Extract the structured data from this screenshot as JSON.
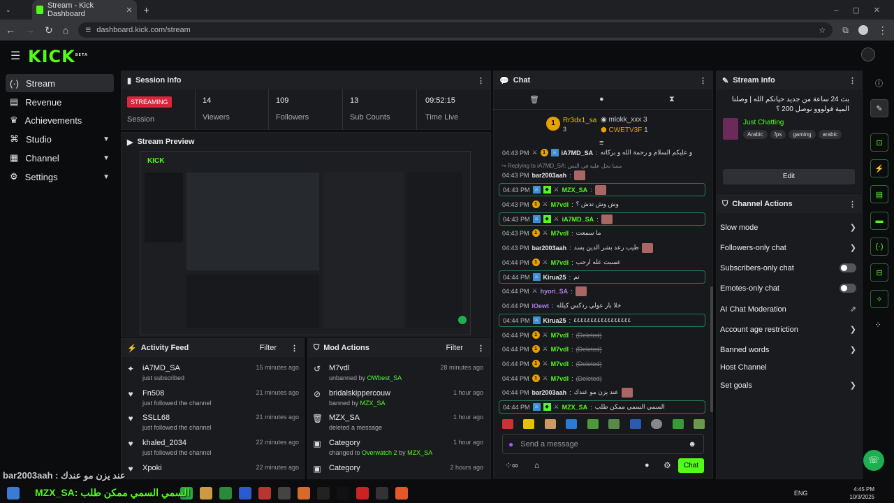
{
  "browser": {
    "tab_title": "Stream - Kick Dashboard",
    "url": "dashboard.kick.com/stream"
  },
  "brand": {
    "logo": "KICK",
    "beta": "BETA",
    "accent": "#53fc18"
  },
  "nav": {
    "items": [
      {
        "label": "Stream",
        "icon": "stream-icon",
        "active": true
      },
      {
        "label": "Revenue",
        "icon": "revenue-icon"
      },
      {
        "label": "Achievements",
        "icon": "trophy-icon"
      },
      {
        "label": "Studio",
        "icon": "studio-icon",
        "expandable": true
      },
      {
        "label": "Channel",
        "icon": "channel-icon",
        "expandable": true
      },
      {
        "label": "Settings",
        "icon": "gear-icon",
        "expandable": true
      }
    ]
  },
  "session": {
    "title": "Session Info",
    "status_badge": "STREAMING",
    "status_label": "Session",
    "stats": [
      {
        "value": "14",
        "label": "Viewers"
      },
      {
        "value": "109",
        "label": "Followers"
      },
      {
        "value": "13",
        "label": "Sub Counts"
      },
      {
        "value": "09:52:15",
        "label": "Time Live"
      }
    ]
  },
  "preview": {
    "title": "Stream Preview"
  },
  "activity": {
    "title": "Activity Feed",
    "filter": "Filter",
    "items": [
      {
        "icon": "star-icon",
        "user": "iA7MD_SA",
        "action": "just subscribed",
        "time": "15 minutes ago"
      },
      {
        "icon": "heart-icon",
        "user": "Fn508",
        "action": "just followed the channel",
        "time": "21 minutes ago"
      },
      {
        "icon": "heart-icon",
        "user": "SSLL68",
        "action": "just followed the channel",
        "time": "21 minutes ago"
      },
      {
        "icon": "heart-icon",
        "user": "khaled_2034",
        "action": "just followed the channel",
        "time": "22 minutes ago"
      },
      {
        "icon": "heart-icon",
        "user": "Xpoki",
        "action": "",
        "time": "22 minutes ago"
      }
    ]
  },
  "mod": {
    "title": "Mod Actions",
    "filter": "Filter",
    "items": [
      {
        "icon": "undo-icon",
        "title": "M7vdl",
        "pre": "unbanned by ",
        "by": "OWbest_SA",
        "time": "28 minutes ago"
      },
      {
        "icon": "ban-icon",
        "title": "bridalskippercouw",
        "pre": "banned by ",
        "by": "MZX_SA",
        "time": "1 hour ago"
      },
      {
        "icon": "trash-icon",
        "title": "MZX_SA",
        "pre": "deleted a message",
        "by": "",
        "time": "1 hour ago"
      },
      {
        "icon": "category-icon",
        "title": "Category",
        "pre": "changed to ",
        "by": "Overwatch 2",
        "by2": " by ",
        "by3": "MZX_SA",
        "time": "1 hour ago"
      },
      {
        "icon": "category-icon",
        "title": "Category",
        "pre": "",
        "by": "",
        "time": "2 hours ago"
      }
    ]
  },
  "chat": {
    "title": "Chat",
    "pinned": [
      {
        "name": "Rr3dx1_sa",
        "count": "3"
      },
      {
        "name": "mlokk_xxx",
        "count": "3"
      },
      {
        "name": "CWETV3F",
        "count": "1"
      }
    ],
    "reply_note": "Replying to iA7MD_SA:",
    "reply_text": "مسا نحل عليه في النص",
    "messages": [
      {
        "ts": "04:43 PM",
        "badges": [
          "sword",
          "sub",
          "mod"
        ],
        "user": "iA7MD_SA",
        "color": "#e8e8e8",
        "text": "و عليكم السلام و رحمة الله و بركاته",
        "hl": false
      },
      {
        "ts": "04:43 PM",
        "badges": [],
        "user": "bar2003aah",
        "color": "#e8e8e8",
        "text": "",
        "emote": true,
        "hl": false
      },
      {
        "ts": "04:43 PM",
        "badges": [
          "mod",
          "vip",
          "sword"
        ],
        "user": "MZX_SA",
        "color": "#53fc18",
        "text": "",
        "emote": true,
        "hl": true
      },
      {
        "ts": "04:43 PM",
        "badges": [
          "sub",
          "sword"
        ],
        "user": "M7vdl",
        "color": "#53fc18",
        "text": "وش وش تدش ؟",
        "hl": false
      },
      {
        "ts": "04:43 PM",
        "badges": [
          "mod",
          "vip",
          "sword"
        ],
        "user": "iA7MD_SA",
        "color": "#53fc18",
        "text": "",
        "emote": true,
        "hl": true
      },
      {
        "ts": "04:43 PM",
        "badges": [
          "sub",
          "sword"
        ],
        "user": "M7vdl",
        "color": "#53fc18",
        "text": "ما سمعت",
        "hl": false
      },
      {
        "ts": "04:43 PM",
        "badges": [],
        "user": "bar2003aah",
        "color": "#e8e8e8",
        "text": "طيب رعد بشر الدين بسد",
        "emote": true,
        "hl": false
      },
      {
        "ts": "04:44 PM",
        "badges": [
          "sub",
          "sword"
        ],
        "user": "M7vdl",
        "color": "#53fc18",
        "text": "عسبت عله ارحب",
        "hl": false
      },
      {
        "ts": "04:44 PM",
        "badges": [
          "mod"
        ],
        "user": "Kirua25",
        "color": "#e8e8e8",
        "text": "تم",
        "hl": true
      },
      {
        "ts": "04:44 PM",
        "badges": [
          "sword"
        ],
        "user": "hyori_SA",
        "color": "#b07ee8",
        "text": "",
        "emote": true,
        "hl": false
      },
      {
        "ts": "04:44 PM",
        "badges": [],
        "user": "lOewt",
        "color": "#b07ee8",
        "text": "خلا بار عولي ردكس كيلله",
        "hl": false
      },
      {
        "ts": "04:44 PM",
        "badges": [
          "mod"
        ],
        "user": "Kirua25",
        "color": "#e8e8e8",
        "text": "٤٤٤٤٤٤٤٤٤٤٤٤٤٤٤٤٤",
        "hl": true
      },
      {
        "ts": "04:44 PM",
        "badges": [
          "sub",
          "sword"
        ],
        "user": "M7vdl",
        "color": "#53fc18",
        "text": "(Deleted)",
        "deleted": true,
        "hl": false
      },
      {
        "ts": "04:44 PM",
        "badges": [
          "sub",
          "sword"
        ],
        "user": "M7vdl",
        "color": "#53fc18",
        "text": "(Deleted)",
        "deleted": true,
        "hl": false
      },
      {
        "ts": "04:44 PM",
        "badges": [
          "sub",
          "sword"
        ],
        "user": "M7vdl",
        "color": "#53fc18",
        "text": "(Deleted)",
        "deleted": true,
        "hl": false
      },
      {
        "ts": "04:44 PM",
        "badges": [
          "sub",
          "sword"
        ],
        "user": "M7vdl",
        "color": "#53fc18",
        "text": "(Deleted)",
        "deleted": true,
        "hl": false
      },
      {
        "ts": "04:44 PM",
        "badges": [],
        "user": "bar2003aah",
        "color": "#e8e8e8",
        "text": "عند يزن مو عندك",
        "emote": true,
        "hl": false
      },
      {
        "ts": "04:44 PM",
        "badges": [
          "mod",
          "vip",
          "sword"
        ],
        "user": "MZX_SA",
        "color": "#53fc18",
        "text": "السمي السمي ممكن طلب",
        "hl": true
      }
    ],
    "input_placeholder": "Send a message",
    "send_label": "Chat"
  },
  "stream_info": {
    "title": "Stream info",
    "stream_title": "بث 24 ساعة من جديد حيانكم الله | وصلنا المية فولووو نوصل 200 ؟",
    "category": "Just Chatting",
    "tags": [
      "Arabic",
      "fps",
      "gaming",
      "arabic"
    ],
    "edit_label": "Edit"
  },
  "channel_actions": {
    "title": "Channel Actions",
    "items": [
      {
        "label": "Slow mode",
        "control": "arrow"
      },
      {
        "label": "Followers-only chat",
        "control": "arrow"
      },
      {
        "label": "Subscribers-only chat",
        "control": "toggle"
      },
      {
        "label": "Emotes-only chat",
        "control": "toggle"
      },
      {
        "label": "AI Chat Moderation",
        "control": "external"
      },
      {
        "label": "Account age restriction",
        "control": "arrow"
      },
      {
        "label": "Banned words",
        "control": "arrow"
      },
      {
        "label": "Host Channel",
        "control": "none"
      },
      {
        "label": "Set goals",
        "control": "arrow"
      }
    ]
  },
  "overlay": {
    "line1": "bar2003aah : عند يزن مو عندك",
    "line2": "MZX_SA: السمي السمي ممكن طلب"
  },
  "taskbar": {
    "lang": "ENG",
    "time": "4:45 PM",
    "date": "10/3/2025"
  }
}
